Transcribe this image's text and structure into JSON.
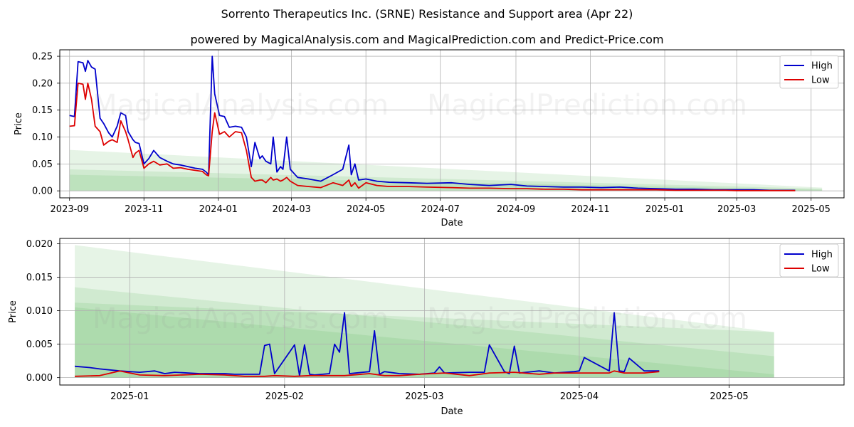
{
  "title": "Sorrento Therapeutics Inc. (SRNE) Resistance and Support area (Apr 22)",
  "subtitle": "powered by MagicalAnalysis.com and MagicalPrediction.com and Predict-Price.com",
  "watermark": {
    "left": "MagicalAnalysis.com",
    "right": "MagicalPrediction.com"
  },
  "colors": {
    "high": "#0000cc",
    "low": "#dd0000",
    "band": "#4caf50"
  },
  "chart_data": [
    {
      "type": "line",
      "xlabel": "Date",
      "ylabel": "Price",
      "xlim": [
        "2023-08-24",
        "2025-05-28"
      ],
      "ylim": [
        -0.013,
        0.262
      ],
      "xticks": [
        "2023-09",
        "2023-11",
        "2024-01",
        "2024-03",
        "2024-05",
        "2024-07",
        "2024-09",
        "2024-11",
        "2025-01",
        "2025-03",
        "2025-05"
      ],
      "xtick_dates": [
        "2023-09-01",
        "2023-11-01",
        "2024-01-01",
        "2024-03-01",
        "2024-05-01",
        "2024-07-01",
        "2024-09-01",
        "2024-11-01",
        "2025-01-01",
        "2025-03-01",
        "2025-05-01"
      ],
      "yticks": [
        "0.00",
        "0.05",
        "0.10",
        "0.15",
        "0.20",
        "0.25"
      ],
      "ytick_values": [
        0,
        0.05,
        0.1,
        0.15,
        0.2,
        0.25
      ],
      "legend": {
        "position": "top-right",
        "entries": [
          "High",
          "Low"
        ]
      },
      "grid": true,
      "bands": [
        {
          "x": [
            "2023-09-01",
            "2025-05-10"
          ],
          "upper": [
            0.076,
            0.006
          ],
          "lower": [
            0,
            0
          ]
        },
        {
          "x": [
            "2023-09-01",
            "2025-05-10"
          ],
          "upper": [
            0.04,
            0.004
          ],
          "lower": [
            0,
            0
          ]
        },
        {
          "x": [
            "2023-09-01",
            "2025-05-10"
          ],
          "upper": [
            0.03,
            0.002
          ],
          "lower": [
            0,
            0
          ]
        }
      ],
      "series": [
        {
          "name": "High",
          "x": [
            "2023-09-01",
            "2023-09-05",
            "2023-09-08",
            "2023-09-12",
            "2023-09-14",
            "2023-09-16",
            "2023-09-19",
            "2023-09-22",
            "2023-09-26",
            "2023-09-29",
            "2023-10-03",
            "2023-10-06",
            "2023-10-10",
            "2023-10-13",
            "2023-10-17",
            "2023-10-19",
            "2023-10-23",
            "2023-10-25",
            "2023-10-28",
            "2023-11-01",
            "2023-11-05",
            "2023-11-09",
            "2023-11-14",
            "2023-11-20",
            "2023-11-25",
            "2023-12-01",
            "2023-12-07",
            "2023-12-13",
            "2023-12-19",
            "2023-12-22",
            "2023-12-24",
            "2023-12-27",
            "2023-12-29",
            "2024-01-02",
            "2024-01-06",
            "2024-01-10",
            "2024-01-15",
            "2024-01-20",
            "2024-01-24",
            "2024-01-28",
            "2024-01-31",
            "2024-02-04",
            "2024-02-06",
            "2024-02-09",
            "2024-02-13",
            "2024-02-15",
            "2024-02-18",
            "2024-02-21",
            "2024-02-23",
            "2024-02-26",
            "2024-02-29",
            "2024-03-06",
            "2024-03-15",
            "2024-03-25",
            "2024-04-04",
            "2024-04-12",
            "2024-04-17",
            "2024-04-19",
            "2024-04-22",
            "2024-04-25",
            "2024-05-01",
            "2024-05-10",
            "2024-05-20",
            "2024-06-05",
            "2024-06-20",
            "2024-07-10",
            "2024-07-25",
            "2024-08-10",
            "2024-08-28",
            "2024-09-10",
            "2024-09-25",
            "2024-10-10",
            "2024-10-25",
            "2024-11-10",
            "2024-11-25",
            "2024-12-10",
            "2024-12-25",
            "2025-01-10",
            "2025-01-25",
            "2025-02-10",
            "2025-02-20",
            "2025-03-01",
            "2025-03-15",
            "2025-03-28",
            "2025-04-08",
            "2025-04-12",
            "2025-04-18"
          ],
          "values": [
            0.14,
            0.138,
            0.24,
            0.238,
            0.222,
            0.242,
            0.23,
            0.226,
            0.135,
            0.125,
            0.108,
            0.1,
            0.12,
            0.145,
            0.14,
            0.11,
            0.095,
            0.09,
            0.088,
            0.05,
            0.06,
            0.075,
            0.062,
            0.055,
            0.05,
            0.048,
            0.045,
            0.042,
            0.04,
            0.035,
            0.03,
            0.25,
            0.18,
            0.14,
            0.138,
            0.118,
            0.12,
            0.118,
            0.1,
            0.045,
            0.09,
            0.06,
            0.065,
            0.055,
            0.05,
            0.1,
            0.035,
            0.045,
            0.04,
            0.1,
            0.04,
            0.025,
            0.022,
            0.018,
            0.03,
            0.04,
            0.085,
            0.03,
            0.05,
            0.02,
            0.022,
            0.018,
            0.016,
            0.015,
            0.014,
            0.015,
            0.012,
            0.01,
            0.012,
            0.009,
            0.008,
            0.007,
            0.007,
            0.006,
            0.007,
            0.005,
            0.004,
            0.003,
            0.003,
            0.002,
            0.002,
            0.002,
            0.002,
            0.001,
            0.001,
            0.001,
            0.001
          ]
        },
        {
          "name": "Low",
          "x": [
            "2023-09-01",
            "2023-09-05",
            "2023-09-08",
            "2023-09-12",
            "2023-09-14",
            "2023-09-16",
            "2023-09-19",
            "2023-09-22",
            "2023-09-26",
            "2023-09-29",
            "2023-10-03",
            "2023-10-06",
            "2023-10-10",
            "2023-10-13",
            "2023-10-17",
            "2023-10-19",
            "2023-10-23",
            "2023-10-25",
            "2023-10-28",
            "2023-11-01",
            "2023-11-05",
            "2023-11-09",
            "2023-11-14",
            "2023-11-20",
            "2023-11-25",
            "2023-12-01",
            "2023-12-07",
            "2023-12-13",
            "2023-12-19",
            "2023-12-22",
            "2023-12-24",
            "2023-12-27",
            "2023-12-29",
            "2024-01-02",
            "2024-01-06",
            "2024-01-10",
            "2024-01-15",
            "2024-01-20",
            "2024-01-24",
            "2024-01-28",
            "2024-01-31",
            "2024-02-04",
            "2024-02-06",
            "2024-02-09",
            "2024-02-13",
            "2024-02-15",
            "2024-02-18",
            "2024-02-21",
            "2024-02-23",
            "2024-02-26",
            "2024-02-29",
            "2024-03-06",
            "2024-03-15",
            "2024-03-25",
            "2024-04-04",
            "2024-04-12",
            "2024-04-17",
            "2024-04-19",
            "2024-04-22",
            "2024-04-25",
            "2024-05-01",
            "2024-05-10",
            "2024-05-20",
            "2024-06-05",
            "2024-06-20",
            "2024-07-10",
            "2024-07-25",
            "2024-08-10",
            "2024-08-28",
            "2024-09-10",
            "2024-09-25",
            "2024-10-10",
            "2024-10-25",
            "2024-11-10",
            "2024-11-25",
            "2024-12-10",
            "2024-12-25",
            "2025-01-10",
            "2025-01-25",
            "2025-02-10",
            "2025-02-20",
            "2025-03-01",
            "2025-03-15",
            "2025-03-28",
            "2025-04-08",
            "2025-04-12",
            "2025-04-18"
          ],
          "values": [
            0.12,
            0.121,
            0.2,
            0.198,
            0.17,
            0.2,
            0.17,
            0.12,
            0.11,
            0.085,
            0.092,
            0.095,
            0.09,
            0.13,
            0.11,
            0.095,
            0.062,
            0.07,
            0.075,
            0.042,
            0.05,
            0.055,
            0.048,
            0.05,
            0.042,
            0.043,
            0.04,
            0.038,
            0.036,
            0.03,
            0.028,
            0.11,
            0.145,
            0.105,
            0.11,
            0.1,
            0.11,
            0.108,
            0.075,
            0.025,
            0.018,
            0.02,
            0.02,
            0.015,
            0.025,
            0.02,
            0.022,
            0.018,
            0.02,
            0.025,
            0.018,
            0.01,
            0.008,
            0.006,
            0.015,
            0.01,
            0.02,
            0.008,
            0.015,
            0.005,
            0.015,
            0.01,
            0.008,
            0.008,
            0.007,
            0.006,
            0.005,
            0.005,
            0.004,
            0.004,
            0.003,
            0.003,
            0.002,
            0.002,
            0.002,
            0.002,
            0.002,
            0.001,
            0.001,
            0.001,
            0.001,
            0.0005,
            0.0005,
            0.0005,
            0.0005,
            0.0005,
            0.0005
          ]
        }
      ]
    },
    {
      "type": "line",
      "xlabel": "Date",
      "ylabel": "Price",
      "xlim": [
        "2024-12-18",
        "2025-05-24"
      ],
      "ylim": [
        -0.0011,
        0.0208
      ],
      "xticks": [
        "2025-01",
        "2025-02",
        "2025-03",
        "2025-04",
        "2025-05"
      ],
      "xtick_dates": [
        "2025-01-01",
        "2025-02-01",
        "2025-03-01",
        "2025-04-01",
        "2025-05-01"
      ],
      "yticks": [
        "0.000",
        "0.005",
        "0.010",
        "0.015",
        "0.020"
      ],
      "ytick_values": [
        0,
        0.005,
        0.01,
        0.015,
        0.02
      ],
      "legend": {
        "position": "top-right",
        "entries": [
          "High",
          "Low"
        ]
      },
      "grid": true,
      "bands": [
        {
          "x": [
            "2024-12-21",
            "2025-05-10"
          ],
          "upper": [
            0.0198,
            0.0068
          ],
          "lower": [
            0,
            0
          ]
        },
        {
          "x": [
            "2024-12-21",
            "2025-05-10"
          ],
          "upper": [
            0.0135,
            0.0032
          ],
          "lower": [
            0,
            0
          ]
        },
        {
          "x": [
            "2024-12-21",
            "2025-05-10"
          ],
          "upper": [
            0.0112,
            0.0068
          ],
          "lower": [
            0,
            0
          ]
        },
        {
          "x": [
            "2024-12-21",
            "2025-05-10"
          ],
          "upper": [
            0.0105,
            0.0005
          ],
          "lower": [
            0,
            0
          ]
        }
      ],
      "series": [
        {
          "name": "High",
          "x": [
            "2024-12-21",
            "2024-12-24",
            "2024-12-26",
            "2024-12-30",
            "2025-01-03",
            "2025-01-06",
            "2025-01-08",
            "2025-01-10",
            "2025-01-15",
            "2025-01-20",
            "2025-01-22",
            "2025-01-24",
            "2025-01-27",
            "2025-01-28",
            "2025-01-29",
            "2025-01-30",
            "2025-02-03",
            "2025-02-04",
            "2025-02-05",
            "2025-02-06",
            "2025-02-07",
            "2025-02-10",
            "2025-02-11",
            "2025-02-12",
            "2025-02-13",
            "2025-02-14",
            "2025-02-18",
            "2025-02-19",
            "2025-02-20",
            "2025-02-21",
            "2025-02-24",
            "2025-02-28",
            "2025-03-03",
            "2025-03-04",
            "2025-03-05",
            "2025-03-10",
            "2025-03-13",
            "2025-03-14",
            "2025-03-17",
            "2025-03-18",
            "2025-03-19",
            "2025-03-20",
            "2025-03-24",
            "2025-03-27",
            "2025-03-31",
            "2025-04-01",
            "2025-04-02",
            "2025-04-07",
            "2025-04-08",
            "2025-04-09",
            "2025-04-10",
            "2025-04-11",
            "2025-04-14",
            "2025-04-17"
          ],
          "values": [
            0.0017,
            0.0015,
            0.0013,
            0.001,
            0.0008,
            0.001,
            0.0006,
            0.0008,
            0.0006,
            0.0006,
            0.0005,
            0.0005,
            0.0005,
            0.0048,
            0.005,
            0.0006,
            0.0049,
            0.0003,
            0.0049,
            0.0005,
            0.0004,
            0.0006,
            0.005,
            0.0038,
            0.0097,
            0.0006,
            0.0009,
            0.007,
            0.0005,
            0.0009,
            0.0006,
            0.0005,
            0.0007,
            0.0016,
            0.0007,
            0.0008,
            0.0008,
            0.0049,
            0.0009,
            0.0006,
            0.0047,
            0.0007,
            0.001,
            0.0007,
            0.0009,
            0.001,
            0.003,
            0.001,
            0.0097,
            0.001,
            0.0009,
            0.0029,
            0.001,
            0.001
          ]
        },
        {
          "name": "Low",
          "x": [
            "2024-12-21",
            "2024-12-26",
            "2024-12-30",
            "2025-01-03",
            "2025-01-08",
            "2025-01-15",
            "2025-01-20",
            "2025-01-24",
            "2025-01-28",
            "2025-01-30",
            "2025-02-03",
            "2025-02-06",
            "2025-02-10",
            "2025-02-13",
            "2025-02-18",
            "2025-02-21",
            "2025-02-24",
            "2025-02-28",
            "2025-03-05",
            "2025-03-10",
            "2025-03-14",
            "2025-03-19",
            "2025-03-24",
            "2025-03-27",
            "2025-03-31",
            "2025-04-03",
            "2025-04-07",
            "2025-04-08",
            "2025-04-10",
            "2025-04-14",
            "2025-04-17"
          ],
          "values": [
            0.0002,
            0.0003,
            0.001,
            0.0004,
            0.0003,
            0.0005,
            0.0004,
            0.0002,
            0.0002,
            0.0003,
            0.0002,
            0.0003,
            0.0003,
            0.0003,
            0.0006,
            0.0003,
            0.0003,
            0.0005,
            0.0007,
            0.0003,
            0.0007,
            0.0008,
            0.0005,
            0.0007,
            0.0007,
            0.0007,
            0.0007,
            0.001,
            0.0007,
            0.0007,
            0.0009
          ]
        }
      ]
    }
  ]
}
